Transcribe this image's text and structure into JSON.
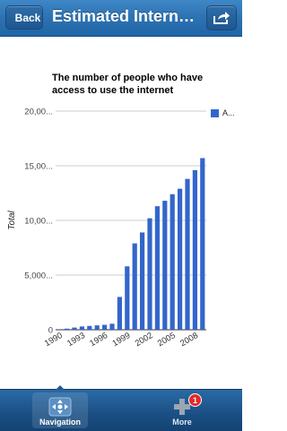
{
  "navbar": {
    "back_label": "Back",
    "title": "Estimated Interne...",
    "share_icon": "share-arrow-icon"
  },
  "chart_data": {
    "type": "bar",
    "title": "The number of people who have access to use the internet",
    "ylabel": "Total",
    "xlabel": "",
    "ylim": [
      0,
      20000
    ],
    "yticks": [
      0,
      5000,
      10000,
      15000,
      20000
    ],
    "ytick_labels": [
      "0",
      "5,000...",
      "10,00...",
      "15,00...",
      "20,00..."
    ],
    "xtick_labels": [
      "1990",
      "1993",
      "1996",
      "1999",
      "2002",
      "2005",
      "2008"
    ],
    "grid": "horizontal",
    "legend_position": "right",
    "series": [
      {
        "name": "A...",
        "color": "#3366cc",
        "x": [
          1990,
          1991,
          1992,
          1993,
          1994,
          1995,
          1996,
          1997,
          1998,
          1999,
          2000,
          2001,
          2002,
          2003,
          2004,
          2005,
          2006,
          2007,
          2008,
          2009
        ],
        "values": [
          50,
          100,
          200,
          300,
          350,
          400,
          450,
          550,
          3000,
          5800,
          7900,
          8900,
          10200,
          11300,
          11800,
          12400,
          12900,
          13800,
          14600,
          15700
        ]
      }
    ]
  },
  "tabbar": {
    "items": [
      {
        "label": "Navigation",
        "icon": "navigation-arrows-icon",
        "selected": true
      },
      {
        "label": "More",
        "icon": "plus-icon",
        "badge": "1",
        "selected": false
      }
    ]
  }
}
